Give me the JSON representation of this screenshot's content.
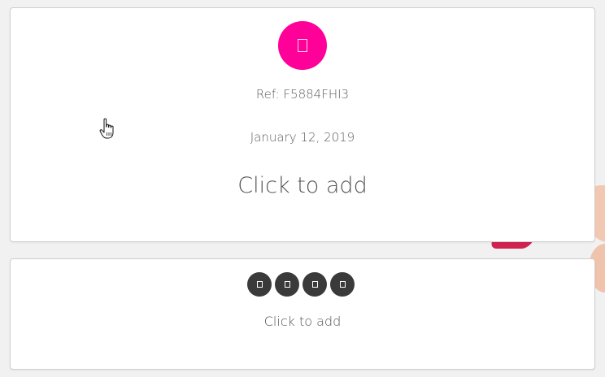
{
  "summary_card": {
    "avatar_icon": "placeholder-glyph-icon",
    "avatar_color": "#ff0099",
    "reference": "Ref: F5884FHI3",
    "date": "January 12, 2019",
    "add_label": "Click to add"
  },
  "actions_card": {
    "icons": [
      {
        "name": "placeholder-glyph-icon"
      },
      {
        "name": "placeholder-glyph-icon"
      },
      {
        "name": "placeholder-glyph-icon"
      },
      {
        "name": "placeholder-glyph-icon"
      }
    ],
    "icon_color": "#3a3a3a",
    "add_label": "Click to add"
  }
}
